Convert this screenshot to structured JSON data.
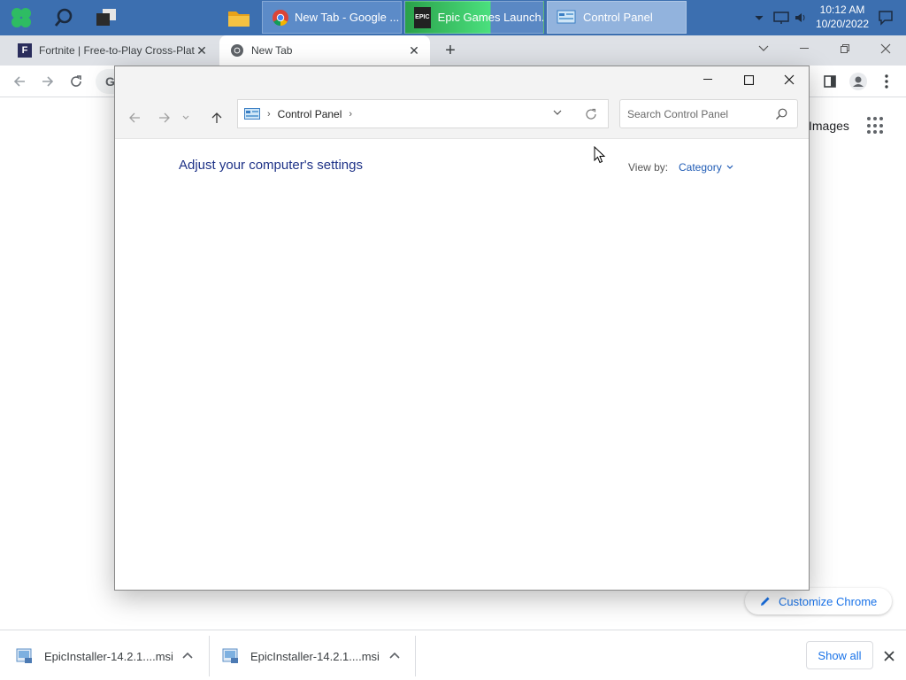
{
  "taskbar": {
    "buttons": [
      {
        "label": "New Tab - Google ..."
      },
      {
        "label": "Epic Games Launch..."
      },
      {
        "label": "Control Panel"
      }
    ],
    "clock": {
      "time": "10:12 AM",
      "date": "10/20/2022"
    }
  },
  "chrome": {
    "tabs": [
      {
        "title": "Fortnite | Free-to-Play Cross-Plat"
      },
      {
        "title": "New Tab"
      }
    ],
    "newtab": {
      "images_link": "Images",
      "customize_label": "Customize Chrome"
    },
    "downloads": {
      "items": [
        {
          "name": "EpicInstaller-14.2.1....msi"
        },
        {
          "name": "EpicInstaller-14.2.1....msi"
        }
      ],
      "show_all": "Show all"
    }
  },
  "control_panel": {
    "breadcrumb": [
      "Control Panel"
    ],
    "search_placeholder": "Search Control Panel",
    "heading": "Adjust your computer's settings",
    "view_by_label": "View by:",
    "view_by_value": "Category"
  }
}
